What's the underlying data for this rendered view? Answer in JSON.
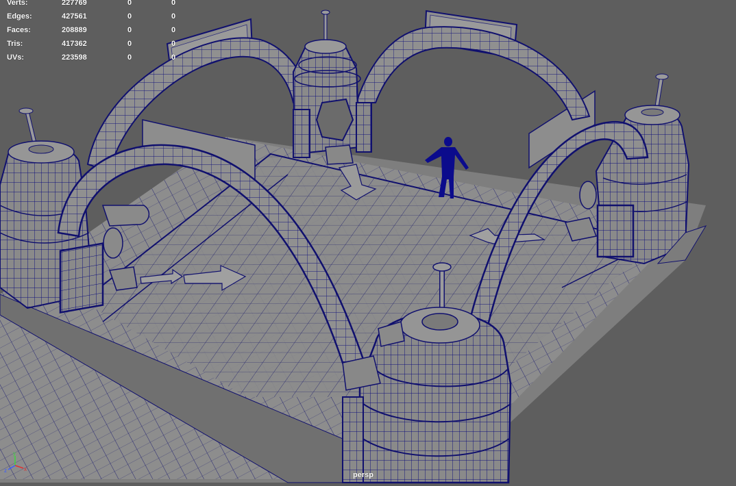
{
  "hud": {
    "rows": [
      {
        "label": "Verts:",
        "total": "227769",
        "selected": "0",
        "component": "0"
      },
      {
        "label": "Edges:",
        "total": "427561",
        "selected": "0",
        "component": "0"
      },
      {
        "label": "Faces:",
        "total": "208889",
        "selected": "0",
        "component": "0"
      },
      {
        "label": "Tris:",
        "total": "417362",
        "selected": "0",
        "component": "0"
      },
      {
        "label": "UVs:",
        "total": "223598",
        "selected": "0",
        "component": "0"
      }
    ]
  },
  "camera": {
    "name": "persp"
  },
  "axis": {
    "x": "x",
    "y": "y",
    "z": "z"
  },
  "colors": {
    "background": "#5e5e5e",
    "mesh_fill": "#8a8a8a",
    "mesh_shadow": "#6f6f6f",
    "wire": "#0a0a7a",
    "character": "#0b0b8c",
    "hud_text": "#ffffff"
  }
}
